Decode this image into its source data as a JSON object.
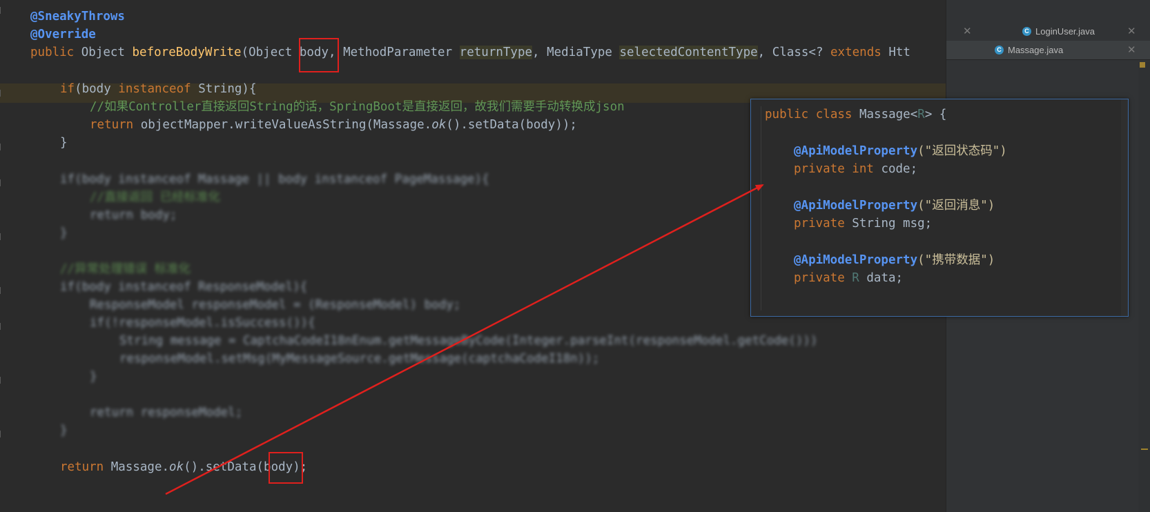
{
  "editor": {
    "ann_sneaky": "@SneakyThrows",
    "ann_override": "@Override",
    "sig": {
      "kw_public": "public",
      "ret_type": " Object ",
      "method": "beforeBodyWrite",
      "open": "(Object ",
      "p_body": "body",
      "sep1": ", MethodParameter ",
      "p_return": "returnType",
      "sep2": ", MediaType ",
      "p_selected": "selectedContentType",
      "sep3": ", Class<? ",
      "kw_extends": "extends",
      "tail": " Htt"
    },
    "if1": {
      "kw": "if",
      "a": "(body ",
      "kw2": "instanceof",
      "b": " String){"
    },
    "comment1": "//如果Controller直接返回String的话，SpringBoot是直接返回，故我们需要手动转换成json",
    "ret1": {
      "kw": "return",
      "a": " objectMapper.writeValueAsString(Massage.",
      "ok": "ok",
      "b": "().setData(body));"
    },
    "brace": "}",
    "blur_if2": "if(body instanceof Massage || body instanceof PageMassage){",
    "blur_c2": "//直接返回 已经标准化",
    "blur_r2": "return body;",
    "blur_b2": "}",
    "blur_c3": "//异常处理错误 标准化",
    "blur_if3": "if(body instanceof ResponseModel){",
    "blur_l4": "ResponseModel responseModel = (ResponseModel) body;",
    "blur_l5": "if(!responseModel.isSuccess()){",
    "blur_l6": "String message = CaptchaCodeI18nEnum.getMessageByCode(Integer.parseInt(responseModel.getCode()))",
    "blur_l7": "responseModel.setMsg(MyMessageSource.getMessage(captchaCodeI18n));",
    "blur_l8": "}",
    "blur_l9": "return responseModel;",
    "blur_l10": "}",
    "ret_final": {
      "kw": "return",
      "a": " Massage.",
      "ok": "ok",
      "b": "().setData(",
      "body": "body",
      "c": ");"
    }
  },
  "tabs": [
    {
      "label": "LoginUser.java",
      "icon": "class-icon"
    },
    {
      "label": "Massage.java",
      "icon": "class-icon"
    }
  ],
  "popup": {
    "l1": {
      "a": "public class ",
      "b": "Massage<",
      "t": "R",
      "c": "> {"
    },
    "ann": "@ApiModelProperty",
    "s1": "(\"返回状态码\")",
    "f1": {
      "kw": "private int",
      "name": " code;"
    },
    "s2": "(\"返回消息\")",
    "f2": {
      "kw": "private",
      "type": " String msg;"
    },
    "s3": "(\"携带数据\")",
    "f3": {
      "kw": "private",
      "t": " R",
      "name": " data;"
    }
  },
  "colors": {
    "annotation_box": "#e0201d",
    "arrow": "#e0201d",
    "popup_border": "#3d6aa3"
  }
}
